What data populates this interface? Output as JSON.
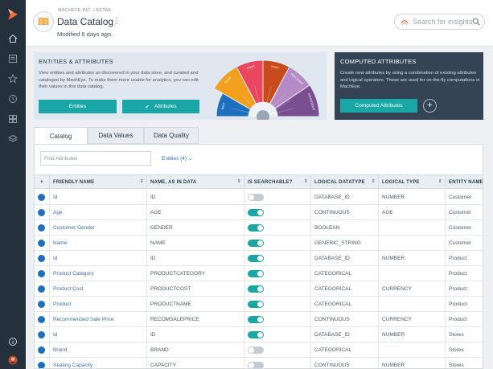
{
  "header": {
    "breadcrumb": "MACHEYE INC. / RETAIL",
    "title": "Data Catalog",
    "kebab": "⋮",
    "modified": "Modified 6 days ago.",
    "search_placeholder": "Search for insights"
  },
  "entities_panel": {
    "title": "ENTITIES & ATTRIBUTES",
    "description": "View entities and attributes as discovered in your data store, and curated and cataloged by MachEye. To make them more usable for analytics, you can edit their values in this data catalog.",
    "entities_button": "Entities",
    "attributes_button": "Attributes",
    "gauge_labels": [
      "GOOD",
      "BETTER",
      "POOR",
      "RISKY",
      "VERY RISKY",
      "DANGEROUS",
      "BEST"
    ],
    "gauge_level": 0.12
  },
  "computed_panel": {
    "title": "COMPUTED ATTRIBUTES",
    "description": "Create new attributes by using a combination of existing attributes and logical operators. These are used for on-the-fly computations in MachEye.",
    "button": "Computed Attributes",
    "plus": "+"
  },
  "tabs": [
    "Catalog",
    "Data Values",
    "Data Quality"
  ],
  "filter": {
    "placeholder": "Find Attributes",
    "entities_filter": "Entities (4) ⌄"
  },
  "table": {
    "headers": [
      "FRIENDLY NAME",
      "NAME, AS IN DATA",
      "IS SEARCHABLE?",
      "LOGICAL DATATYPE",
      "LOGICAL TYPE",
      "ENTITY NAME"
    ],
    "rows": [
      {
        "friendly": "Id",
        "name": "ID",
        "searchable": false,
        "datatype": "DATABASE_ID",
        "ltype": "NUMBER",
        "entity": "Customer"
      },
      {
        "friendly": "Age",
        "name": "AGE",
        "searchable": true,
        "datatype": "CONTINUOUS",
        "ltype": "AGE",
        "entity": "Customer"
      },
      {
        "friendly": "Customer Gender",
        "name": "GENDER",
        "searchable": true,
        "datatype": "BOOLEAN",
        "ltype": "",
        "entity": "Customer"
      },
      {
        "friendly": "Name",
        "name": "NAME",
        "searchable": true,
        "datatype": "GENERIC_STRING",
        "ltype": "",
        "entity": "Customer"
      },
      {
        "friendly": "Id",
        "name": "ID",
        "searchable": true,
        "datatype": "DATABASE_ID",
        "ltype": "NUMBER",
        "entity": "Product"
      },
      {
        "friendly": "Product Category",
        "name": "PRODUCTCATEGORY",
        "searchable": true,
        "datatype": "CATEGORICAL",
        "ltype": "",
        "entity": "Product"
      },
      {
        "friendly": "Product Cost",
        "name": "PRODUCTCOST",
        "searchable": true,
        "datatype": "CATEGORICAL",
        "ltype": "CURRENCY",
        "entity": "Product"
      },
      {
        "friendly": "Product",
        "name": "PRODUCTNAME",
        "searchable": true,
        "datatype": "CATEGORICAL",
        "ltype": "",
        "entity": "Product"
      },
      {
        "friendly": "Recommended Sale Price",
        "name": "RECOMSALEPRICE",
        "searchable": true,
        "datatype": "CONTINUOUS",
        "ltype": "CURRENCY",
        "entity": "Product"
      },
      {
        "friendly": "Id",
        "name": "ID",
        "searchable": true,
        "datatype": "DATABASE_ID",
        "ltype": "NUMBER",
        "entity": "Stores"
      },
      {
        "friendly": "Brand",
        "name": "BRAND",
        "searchable": false,
        "datatype": "CATEGORICAL",
        "ltype": "",
        "entity": "Stores"
      },
      {
        "friendly": "Seating Capacity",
        "name": "CAPACITY",
        "searchable": false,
        "datatype": "CONTINUOUS",
        "ltype": "NUMBER",
        "entity": "Stores"
      }
    ]
  },
  "colors": {
    "teal": "#19a6a5",
    "sidebar": "#25303d",
    "computed_panel": "#354455",
    "row_dot": "#1f6fbf"
  }
}
